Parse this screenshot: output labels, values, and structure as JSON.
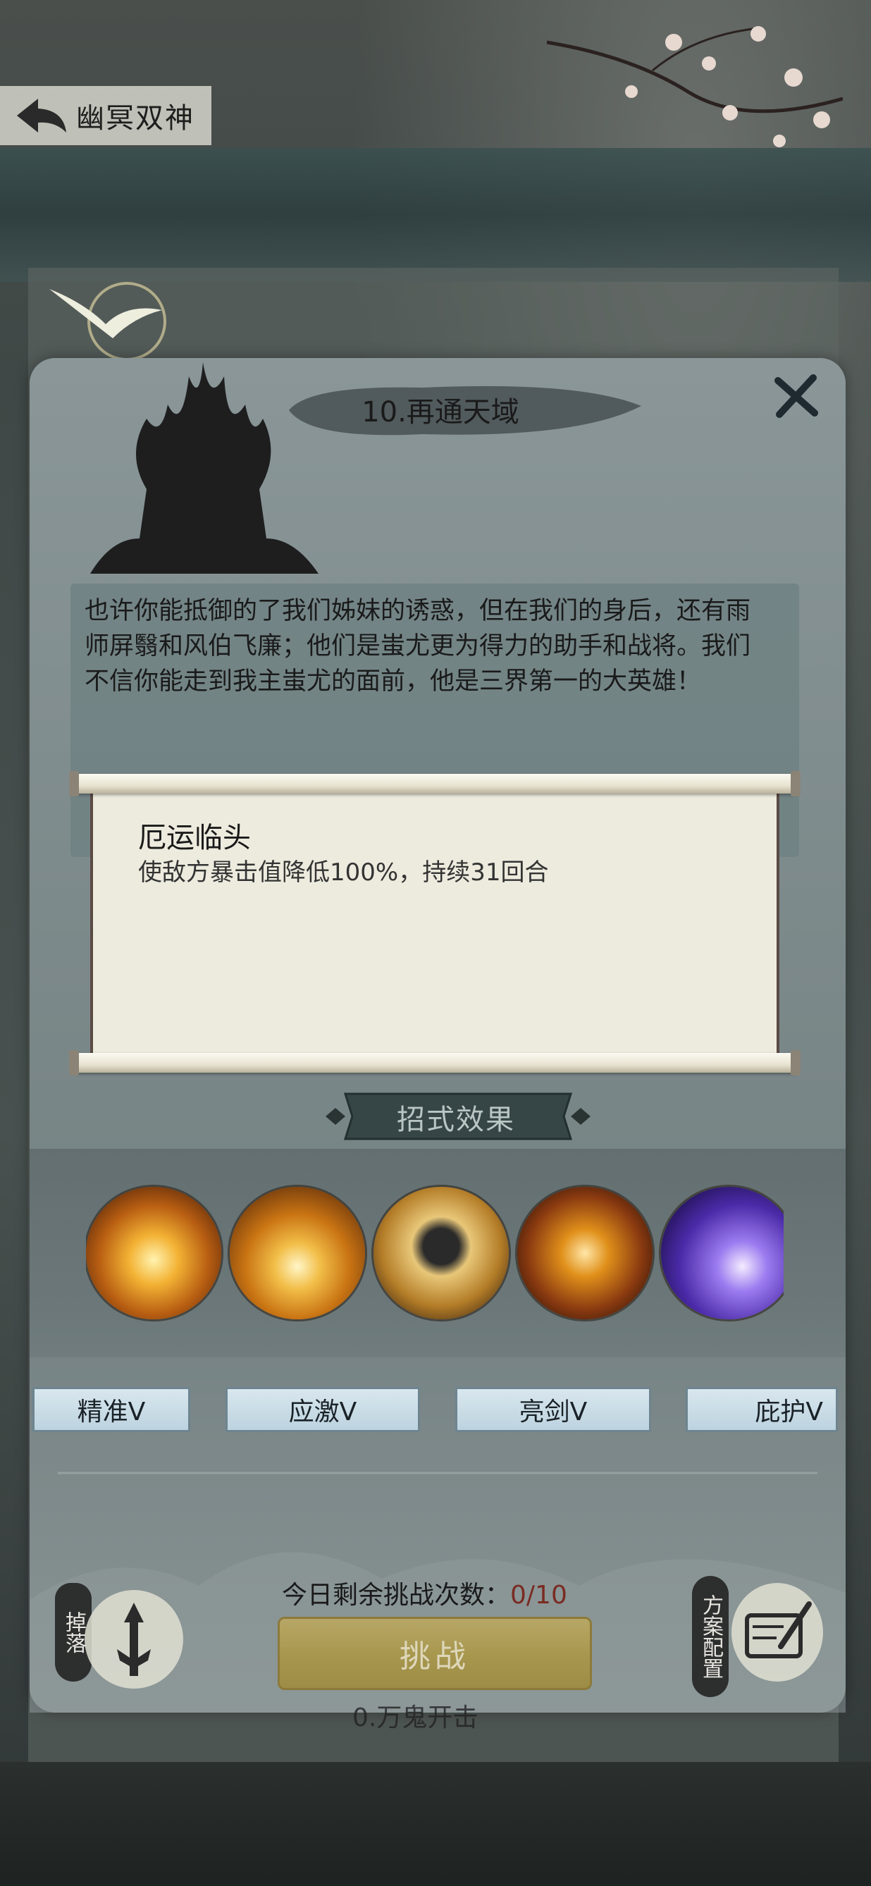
{
  "nav": {
    "back_label": "幽冥双神"
  },
  "stage": {
    "title": "10.再通天域"
  },
  "story": {
    "text": "也许你能抵御的了我们姊妹的诱惑，但在我们的身后，还有雨师屏翳和风伯飞廉；他们是蚩尤更为得力的助手和战将。我们不信你能走到我主蚩尤的面前，他是三界第一的大英雄！"
  },
  "effect_popup": {
    "name": "厄运临头",
    "description": "使敌方暴击值降低100%，持续31回合"
  },
  "skills": {
    "section_title": "招式效果",
    "icons": [
      "explosion-skill-icon",
      "vortex-skill-icon",
      "armored-boss-skill-icon",
      "fire-ring-skill-icon",
      "purple-lightning-skill-icon"
    ],
    "tags": [
      {
        "label": "精准V"
      },
      {
        "label": "应激V"
      },
      {
        "label": "亮剑V"
      },
      {
        "label": "庇护V"
      }
    ]
  },
  "footer": {
    "drop_label": "掉落",
    "plan_label": "方案配置",
    "attempts_label": "今日剩余挑战次数：",
    "attempts_value": "0/10",
    "challenge_label": "挑战",
    "under_text": "0.万鬼开击"
  },
  "colors": {
    "panel": "#808c8e",
    "challenge_button": "#a8984f",
    "attempts_value": "#7a2b22",
    "tag_fill": "#c9dce6"
  }
}
